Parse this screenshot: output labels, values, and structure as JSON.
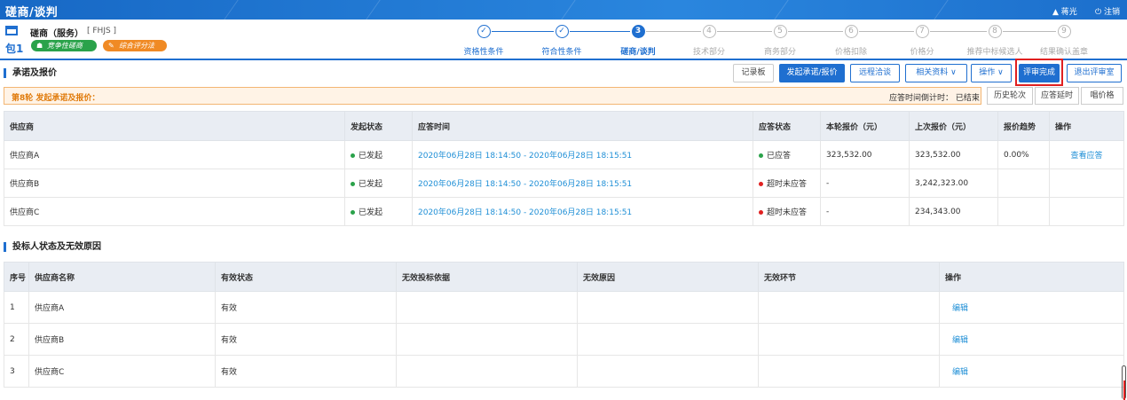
{
  "topbar": {
    "title": "磋商/谈判",
    "user": "▲ 蒋光",
    "logout": "⏻ 注销"
  },
  "project": {
    "name": "磋商（服务）",
    "code": "[ FHJS ]",
    "package": "包1",
    "tags": [
      {
        "icon": "☗",
        "label": "竞争性磋商"
      },
      {
        "icon": "✎",
        "label": "综合评分法"
      }
    ]
  },
  "steps": [
    {
      "mark": "✓",
      "label": "资格性条件",
      "state": "done"
    },
    {
      "mark": "✓",
      "label": "符合性条件",
      "state": "done"
    },
    {
      "mark": "3",
      "label": "磋商/谈判",
      "state": "active"
    },
    {
      "mark": "4",
      "label": "技术部分",
      "state": "todo"
    },
    {
      "mark": "5",
      "label": "商务部分",
      "state": "todo"
    },
    {
      "mark": "6",
      "label": "价格扣除",
      "state": "todo"
    },
    {
      "mark": "7",
      "label": "价格分",
      "state": "todo"
    },
    {
      "mark": "8",
      "label": "推荐中标候选人",
      "state": "todo"
    },
    {
      "mark": "9",
      "label": "结果确认盖章",
      "state": "todo"
    }
  ],
  "section1": {
    "title": "承诺及报价",
    "buttons": {
      "log": "记录板",
      "start": "发起承诺/报价",
      "remote": "远程洽谈",
      "docs": "相关资料 ∨",
      "ops": "操作 ∨",
      "finish": "评审完成",
      "exit": "退出评审室"
    }
  },
  "round": {
    "title": "第8轮 发起承诺及报价：",
    "countdown": "应答时间倒计时：  已结束",
    "buttons": {
      "history": "历史轮次",
      "delay": "应答延时",
      "bid": "唱价格"
    }
  },
  "quote_table": {
    "headers": [
      "供应商",
      "发起状态",
      "应答时间",
      "应答状态",
      "本轮报价（元）",
      "上次报价（元）",
      "报价趋势",
      "操作"
    ],
    "rows": [
      {
        "supplier": "供应商A",
        "start": "已发起",
        "time": "2020年06月28日 18:14:50 - 2020年06月28日 18:15:51",
        "status": "已应答",
        "status_color": "green",
        "price": "323,532.00",
        "last": "323,532.00",
        "trend": "0.00%",
        "op": "查看应答"
      },
      {
        "supplier": "供应商B",
        "start": "已发起",
        "time": "2020年06月28日 18:14:50 - 2020年06月28日 18:15:51",
        "status": "超时未应答",
        "status_color": "red",
        "price": "-",
        "last": "3,242,323.00",
        "trend": "",
        "op": ""
      },
      {
        "supplier": "供应商C",
        "start": "已发起",
        "time": "2020年06月28日 18:14:50 - 2020年06月28日 18:15:51",
        "status": "超时未应答",
        "status_color": "red",
        "price": "-",
        "last": "234,343.00",
        "trend": "",
        "op": ""
      }
    ]
  },
  "section2": {
    "title": "投标人状态及无效原因"
  },
  "bidder_table": {
    "headers": [
      "序号",
      "供应商名称",
      "有效状态",
      "无效投标依据",
      "无效原因",
      "无效环节",
      "操作"
    ],
    "rows": [
      {
        "no": "1",
        "name": "供应商A",
        "valid": "有效",
        "basis": "",
        "reason": "",
        "stage": "",
        "op": "编辑"
      },
      {
        "no": "2",
        "name": "供应商B",
        "valid": "有效",
        "basis": "",
        "reason": "",
        "stage": "",
        "op": "编辑"
      },
      {
        "no": "3",
        "name": "供应商C",
        "valid": "有效",
        "basis": "",
        "reason": "",
        "stage": "",
        "op": "编辑"
      }
    ]
  }
}
